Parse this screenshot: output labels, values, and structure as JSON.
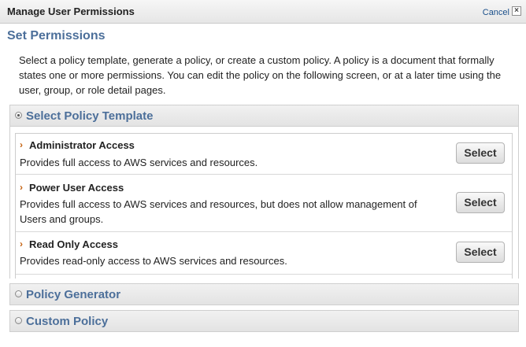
{
  "dialog": {
    "title": "Manage User Permissions",
    "cancel_label": "Cancel",
    "close_glyph": "×"
  },
  "section_title": "Set Permissions",
  "intro_text": "Select a policy template, generate a policy, or create a custom policy. A policy is a document that formally states one or more permissions. You can edit the policy on the following screen, or at a later time using the user, group, or role detail pages.",
  "options": {
    "select_template": {
      "label": "Select Policy Template",
      "selected": true
    },
    "policy_generator": {
      "label": "Policy Generator",
      "selected": false
    },
    "custom_policy": {
      "label": "Custom Policy",
      "selected": false
    }
  },
  "templates": [
    {
      "name": "Administrator Access",
      "description": "Provides full access to AWS services and resources.",
      "button_label": "Select"
    },
    {
      "name": "Power User Access",
      "description": "Provides full access to AWS services and resources, but does not allow management of Users and groups.",
      "button_label": "Select"
    },
    {
      "name": "Read Only Access",
      "description": "Provides read-only access to AWS services and resources.",
      "button_label": "Select"
    }
  ],
  "chevron_glyph": "›",
  "colors": {
    "heading": "#4c6f9a",
    "chevron": "#c4610f",
    "link": "#1a4f8a"
  }
}
